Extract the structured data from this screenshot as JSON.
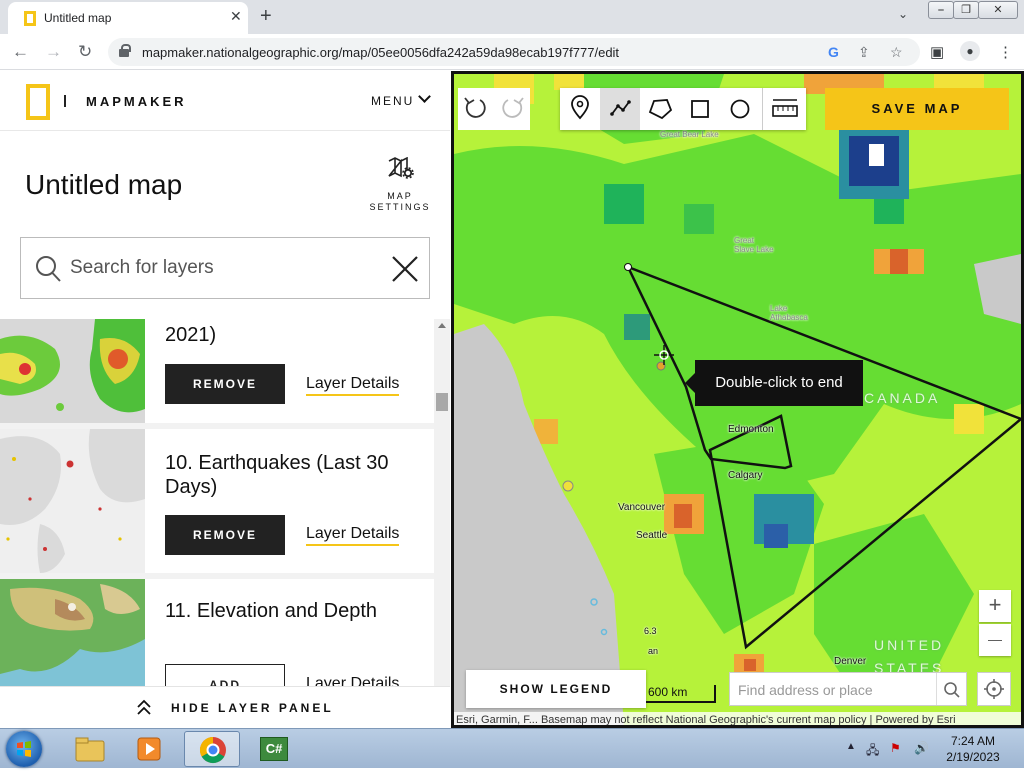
{
  "browser": {
    "tab_title": "Untitled map",
    "tab_close": "✕",
    "new_tab": "+",
    "url": "mapmaker.nationalgeographic.org/map/05ee0056dfa242a59da98ecab197f777/edit",
    "window_buttons": [
      "⎯",
      "❐",
      "✕"
    ]
  },
  "app": {
    "brand": "MAPMAKER",
    "menu_label": "MENU",
    "map_title": "Untitled map",
    "map_settings_label": "MAP\nSETTINGS",
    "search_placeholder": "Search for layers",
    "hide_panel_label": "HIDE LAYER PANEL"
  },
  "layers": [
    {
      "name": "2021)",
      "action_label": "REMOVE",
      "details_label": "Layer Details"
    },
    {
      "name": "10. Earthquakes (Last 30 Days)",
      "action_label": "REMOVE",
      "details_label": "Layer Details"
    },
    {
      "name": "11. Elevation and Depth",
      "action_label": "ADD",
      "details_label": "Layer Details"
    }
  ],
  "map": {
    "save_label": "SAVE MAP",
    "tooltip": "Double-click to end",
    "show_legend_label": "SHOW LEGEND",
    "scale_label": "600 km",
    "address_placeholder": "Find address or place",
    "attribution": "Esri, Garmin, F...     Basemap may not reflect National Geographic's current map policy | Powered by Esri",
    "zoom_in": "+",
    "zoom_out": "—",
    "labels": {
      "canada": "CANADA",
      "united": "UNITED",
      "states": "STATES",
      "edmonton": "Edmonton",
      "calgary": "Calgary",
      "vancouver": "Vancouver",
      "seattle": "Seattle",
      "denver": "Denver",
      "great_bear": "Great Bear Lake",
      "great_slave": "Great Slave Lake",
      "athabasca": "Lake Athabasca",
      "quake_mag": "6.3",
      "partial_an": "an"
    }
  },
  "taskbar": {
    "time": "7:24 AM",
    "date": "2/19/2023",
    "app_label": "C#"
  },
  "colors": {
    "brand_yellow": "#f5c518",
    "map_green": "#66dd33",
    "map_yellowgreen": "#b6f23a"
  },
  "icons": [
    "map-settings-icon",
    "search-icon",
    "close-icon",
    "undo-icon",
    "redo-icon",
    "point-icon",
    "line-icon",
    "polygon-icon",
    "rectangle-icon",
    "circle-icon",
    "measure-icon",
    "locate-icon"
  ]
}
